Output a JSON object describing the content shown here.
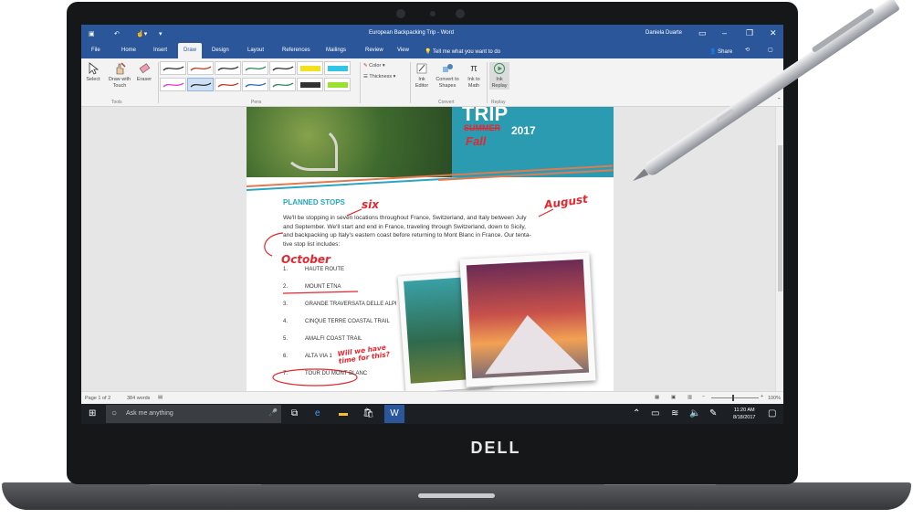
{
  "window": {
    "doc_title": "European Backpacking Trip - Word",
    "user": "Daniela Duarte"
  },
  "ribbon_tabs": [
    "File",
    "Home",
    "Insert",
    "Draw",
    "Design",
    "Layout",
    "References",
    "Mailings",
    "Review",
    "View"
  ],
  "tellme": "Tell me what you want to do",
  "share": "Share",
  "tools": {
    "select": "Select",
    "draw_touch": "Draw with Touch",
    "eraser": "Eraser",
    "group": "Tools"
  },
  "pens_group": "Pens",
  "color_btn": "Color",
  "thickness_btn": "Thickness",
  "convert": {
    "ink_editor": "Ink Editor",
    "convert_shapes": "Convert to Shapes",
    "ink_math": "Ink to Math",
    "group": "Convert"
  },
  "replay": {
    "ink_replay": "Ink Replay",
    "group": "Replay"
  },
  "document": {
    "hero_title": "TRIP",
    "hero_strike": "SUMMER",
    "hero_year": "2017",
    "hero_fall": "Fall",
    "section_title": "PLANNED STOPS",
    "para_line1": "We'll be stopping in seven locations throughout France, Switzerland, and Italy between July",
    "para_line2": "and September. We'll start and end in France, traveling through Switzerland, down to Sicily,",
    "para_line3": "and backpacking up Italy's eastern coast before returning to Mont Blanc in France. Our tenta-",
    "para_line4": "tive stop list includes:",
    "ink_six": "six",
    "ink_august": "August",
    "ink_october": "October",
    "ink_question": "Will we have time for this?",
    "stops": [
      {
        "num": "1.",
        "name": "HAUTE ROUTE"
      },
      {
        "num": "2.",
        "name": "MOUNT ETNA"
      },
      {
        "num": "3.",
        "name": "GRANDE TRAVERSATA DELLE ALPI"
      },
      {
        "num": "4.",
        "name": "CINQUE TERRE COASTAL TRAIL"
      },
      {
        "num": "5.",
        "name": "AMALFI COAST TRAIL"
      },
      {
        "num": "6.",
        "name": "ALTA VIA 1"
      },
      {
        "num": "7.",
        "name": "TOUR DU MONT BLANC"
      }
    ]
  },
  "status": {
    "page": "Page 1 of 2",
    "words": "384 words",
    "zoom": "100%"
  },
  "taskbar": {
    "search_placeholder": "Ask me anything",
    "time": "11:20 AM",
    "date": "8/18/2017"
  },
  "brand": "DELL",
  "colors": {
    "word_blue": "#2b579a",
    "ink_red": "#e6262e",
    "accent_teal": "#29a6c0"
  }
}
